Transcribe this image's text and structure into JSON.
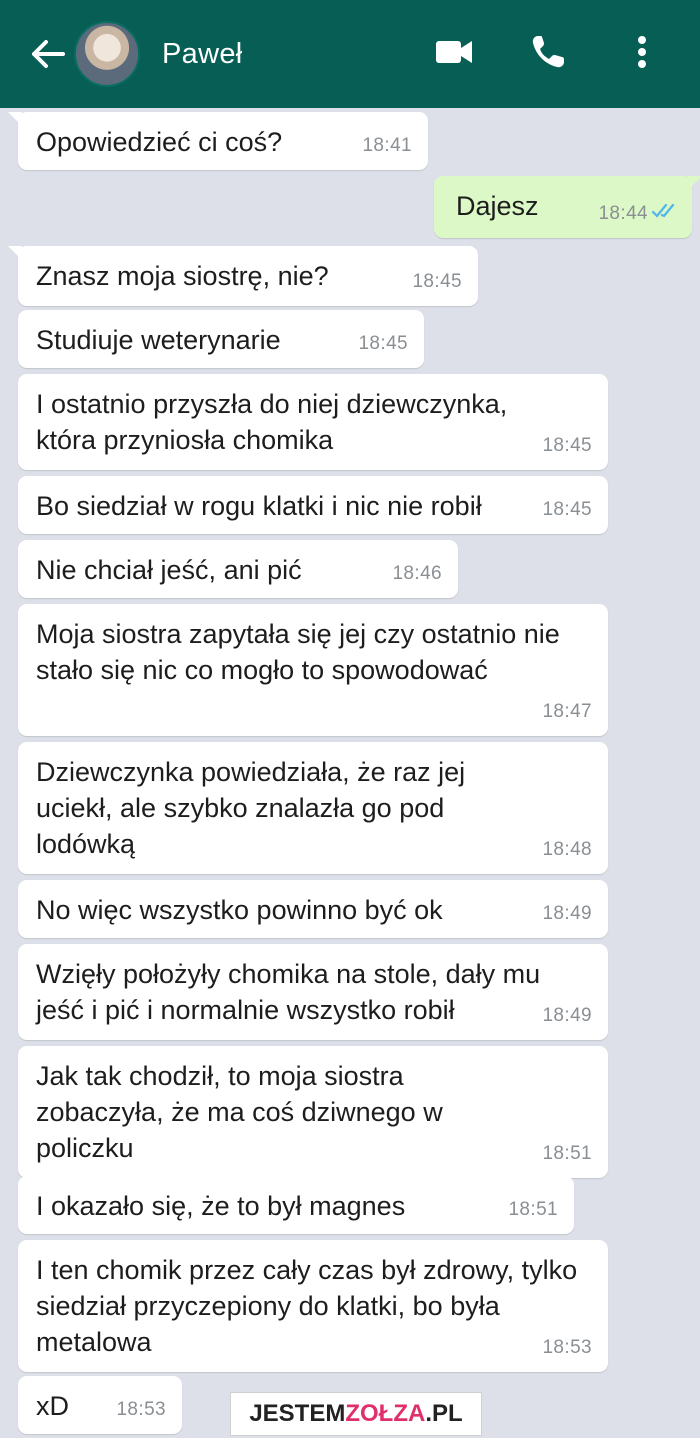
{
  "header": {
    "contact_name": "Paweł",
    "icons": [
      "back-arrow-icon",
      "contact-avatar",
      "video-call-icon",
      "phone-icon",
      "more-options-icon"
    ],
    "color": "#075e54"
  },
  "messages": [
    {
      "dir": "in",
      "text": "Opowiedzieć ci coś?",
      "time": "18:41"
    },
    {
      "dir": "out",
      "text": "Dajesz",
      "time": "18:44",
      "status": "read"
    },
    {
      "dir": "in",
      "text": "Znasz moja siostrę, nie?",
      "time": "18:45"
    },
    {
      "dir": "in",
      "text": "Studiuje weterynarie",
      "time": "18:45"
    },
    {
      "dir": "in",
      "text": "I ostatnio przyszła do niej dziewczynka, która przyniosła chomika",
      "time": "18:45"
    },
    {
      "dir": "in",
      "text": "Bo siedział w rogu klatki i nic nie robił",
      "time": "18:45"
    },
    {
      "dir": "in",
      "text": "Nie chciał jeść, ani pić",
      "time": "18:46"
    },
    {
      "dir": "in",
      "text": "Moja siostra zapytała się jej czy ostatnio nie stało się nic co mogło to spowodować",
      "time": "18:47"
    },
    {
      "dir": "in",
      "text": "Dziewczynka powiedziała, że raz jej uciekł, ale szybko znalazła go pod lodówką",
      "time": "18:48"
    },
    {
      "dir": "in",
      "text": "No więc wszystko powinno być ok",
      "time": "18:49"
    },
    {
      "dir": "in",
      "text": "Wzięły położyły chomika na stole, dały mu jeść i pić i normalnie wszystko robił",
      "time": "18:49"
    },
    {
      "dir": "in",
      "text": "Jak tak chodził, to moja siostra zobaczyła, że ma coś dziwnego w policzku",
      "time": "18:51"
    },
    {
      "dir": "in",
      "text": "I okazało się, że to był magnes",
      "time": "18:51"
    },
    {
      "dir": "in",
      "text": "I ten chomik przez cały czas był zdrowy, tylko siedział przyczepiony do klatki, bo była metalowa",
      "time": "18:53"
    },
    {
      "dir": "in",
      "text": "xD",
      "time": "18:53"
    }
  ],
  "watermark": {
    "part1": "JESTEM",
    "part2": "ZOŁZA",
    "part3": ".PL"
  }
}
